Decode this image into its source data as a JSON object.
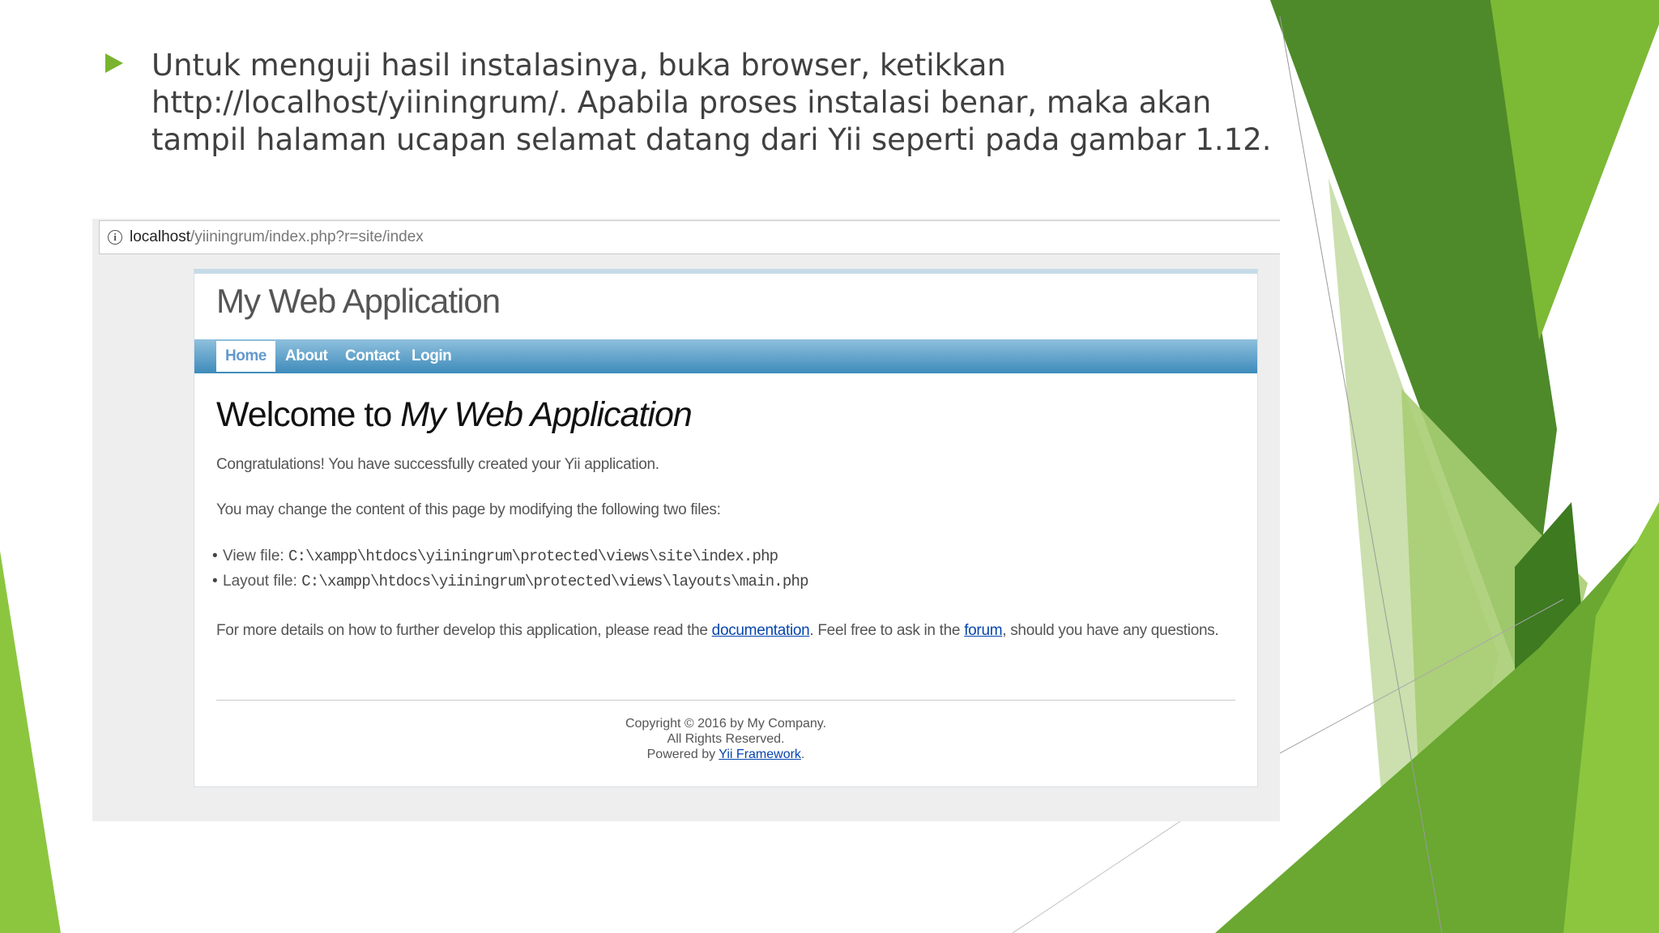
{
  "slide": {
    "bullet_text": "Untuk menguji hasil instalasinya, buka browser, ketikkan\nhttp://localhost/yiiningrum/. Apabila proses instalasi benar, maka akan\ntampil halaman ucapan selamat datang dari Yii seperti pada gambar 1.12.",
    "accent_color": "#7ab32e"
  },
  "browser": {
    "url_host": "localhost",
    "url_path": "/yiiningrum/index.php?r=site/index",
    "info_icon": "info-icon"
  },
  "app": {
    "title": "My Web Application",
    "nav": [
      "Home",
      "About",
      "Contact",
      "Login"
    ],
    "active_nav": "Home",
    "welcome_prefix": "Welcome to",
    "welcome_app": "My Web Application",
    "congrats": "Congratulations! You have successfully created your Yii application.",
    "change_intro": "You may change the content of this page by modifying the following two files:",
    "files": [
      {
        "label": "View file:",
        "path": "C:\\xampp\\htdocs\\yiiningrum\\protected\\views\\site\\index.php"
      },
      {
        "label": "Layout file:",
        "path": "C:\\xampp\\htdocs\\yiiningrum\\protected\\views\\layouts\\main.php"
      }
    ],
    "details": {
      "before": "For more details on how to further develop this application, please read the",
      "link1": "documentation",
      "middle": ". Feel free to ask in the",
      "link2": "forum",
      "after": ", should you have any questions."
    },
    "footer": {
      "copyright": "Copyright © 2016 by My Company.",
      "rights": "All Rights Reserved.",
      "powered_prefix": "Powered by",
      "powered_link": "Yii Framework",
      "powered_suffix": "."
    }
  }
}
